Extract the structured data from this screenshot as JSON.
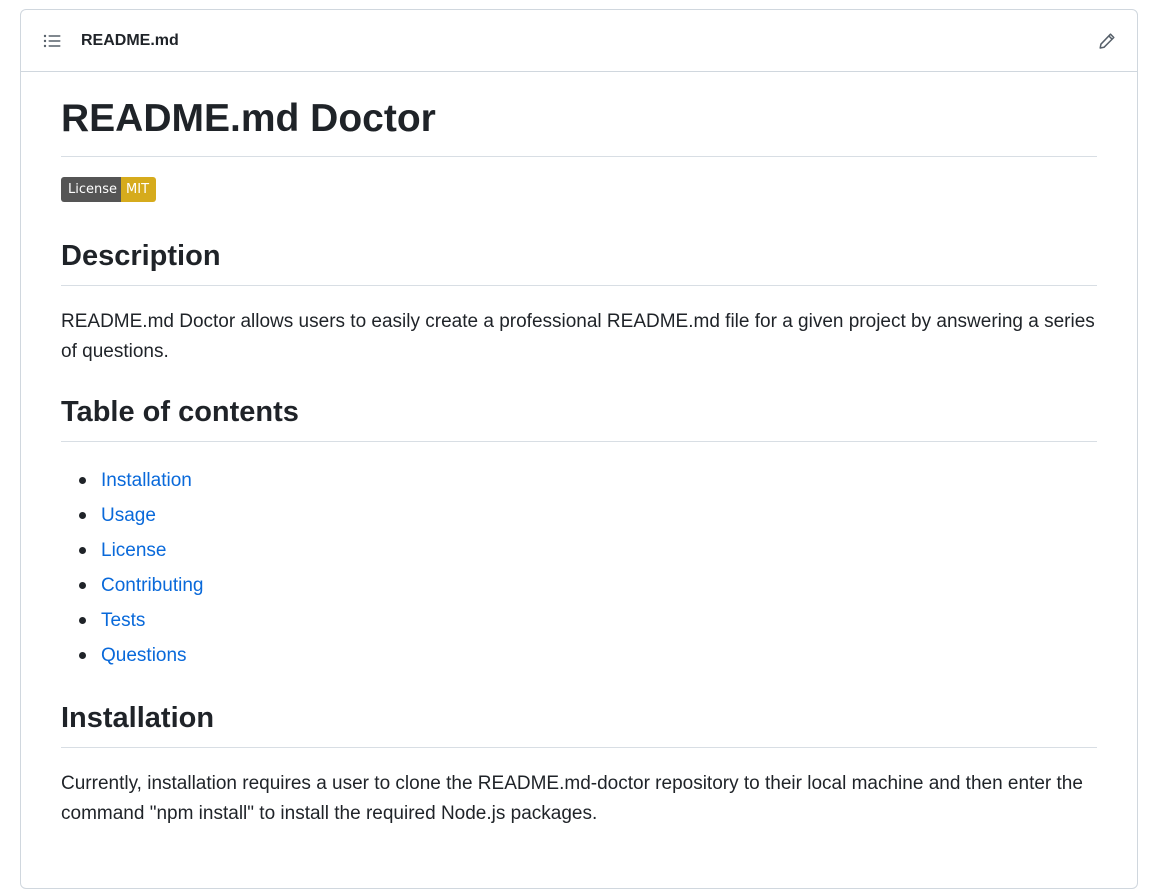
{
  "header": {
    "file_name": "README.md",
    "toc_icon": "list-unordered-icon",
    "edit_icon": "pencil-icon"
  },
  "readme": {
    "title": "README.md Doctor",
    "badge": {
      "label": "License",
      "value": "MIT",
      "label_color": "#555555",
      "value_color": "#d6ab1c"
    },
    "sections": {
      "description": {
        "heading": "Description",
        "text": "README.md Doctor allows users to easily create a professional README.md file for a given project by answering a series of questions."
      },
      "toc": {
        "heading": "Table of contents",
        "items": [
          "Installation",
          "Usage",
          "License",
          "Contributing",
          "Tests",
          "Questions"
        ]
      },
      "installation": {
        "heading": "Installation",
        "text": "Currently, installation requires a user to clone the README.md-doctor repository to their local machine and then enter the command \"npm install\" to install the required Node.js packages."
      }
    }
  },
  "colors": {
    "link": "#0969da",
    "text": "#1f2328",
    "border": "#d0d7de"
  }
}
